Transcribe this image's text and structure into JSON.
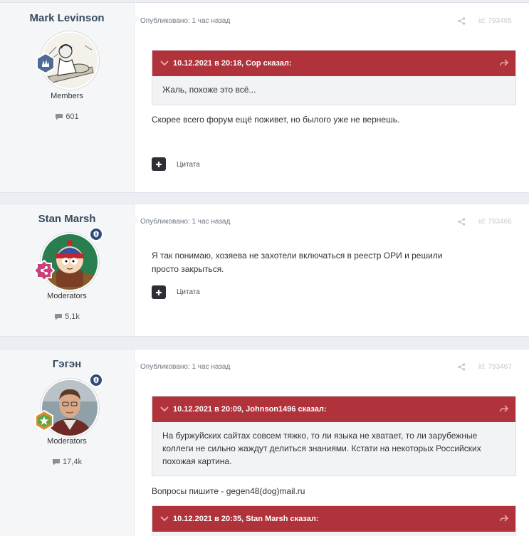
{
  "common": {
    "quote_button_label": "Цитата",
    "published_label": "Опубликовано: 1 час назад"
  },
  "posts": [
    {
      "author": "Mark Levinson",
      "group": "Members",
      "post_count": "601",
      "post_id": "id: 793465",
      "quote": {
        "header": "10.12.2021 в 20:18, Cop сказал:",
        "body": "Жаль, похоже это всё..."
      },
      "text": "Скорее всего форум ещё поживет, но былого уже не вернешь."
    },
    {
      "author": "Stan Marsh",
      "group": "Moderators",
      "post_count": "5,1k",
      "post_id": "id: 793466",
      "text": "Я так понимаю, хозяева не захотели включаться в реестр ОРИ и решили просто закрыться."
    },
    {
      "author": "Гэгэн",
      "group": "Moderators",
      "post_count": "17,4k",
      "post_id": "id: 793467",
      "quote": {
        "header": "10.12.2021 в 20:09, Johnson1496 сказал:",
        "body": "На буржуйских сайтах совсем тяжко, то ли языка не хватает, то ли зарубежные коллеги не сильно жаждут делиться знаниями. Кстати на некоторых Российских похожая картина."
      },
      "text": "Вопросы пишите - gegen48(dog)mail.ru",
      "quote2": {
        "header": "10.12.2021 в 20:35, Stan Marsh сказал:"
      }
    }
  ],
  "colors": {
    "quote_header": "#b0323a",
    "author": "#374a5e",
    "mod_badge": "#2f4b78"
  }
}
